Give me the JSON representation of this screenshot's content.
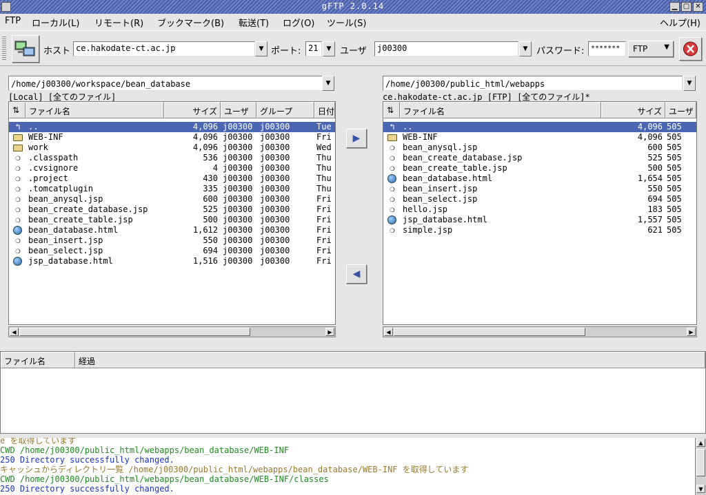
{
  "window": {
    "title": "gFTP 2.0.14"
  },
  "menu": [
    "FTP",
    "ローカル(L)",
    "リモート(R)",
    "ブックマーク(B)",
    "転送(T)",
    "ログ(O)",
    "ツール(S)"
  ],
  "menu_help": "ヘルプ(H)",
  "toolbar": {
    "host_label": "ホスト",
    "host_value": "ce.hakodate-ct.ac.jp",
    "port_label": "ポート:",
    "port_value": "21",
    "user_label": "ユーザ",
    "user_value": "j00300",
    "password_label": "パスワード:",
    "password_value": "*******",
    "protocol_value": "FTP"
  },
  "local": {
    "path": "/home/j00300/workspace/bean_database",
    "status": "[Local] [全てのファイル]",
    "columns": {
      "name": "ファイル名",
      "size": "サイズ",
      "user": "ユーザ",
      "group": "グループ",
      "date": "日付"
    },
    "rows": [
      {
        "icon": "up",
        "name": "..",
        "size": "4,096",
        "user": "j00300",
        "group": "j00300",
        "date": "Tue"
      },
      {
        "icon": "folder",
        "name": "WEB-INF",
        "size": "4,096",
        "user": "j00300",
        "group": "j00300",
        "date": "Fri"
      },
      {
        "icon": "folder",
        "name": "work",
        "size": "4,096",
        "user": "j00300",
        "group": "j00300",
        "date": "Wed"
      },
      {
        "icon": "file",
        "name": ".classpath",
        "size": "536",
        "user": "j00300",
        "group": "j00300",
        "date": "Thu"
      },
      {
        "icon": "file",
        "name": ".cvsignore",
        "size": "4",
        "user": "j00300",
        "group": "j00300",
        "date": "Thu"
      },
      {
        "icon": "file",
        "name": ".project",
        "size": "430",
        "user": "j00300",
        "group": "j00300",
        "date": "Thu"
      },
      {
        "icon": "file",
        "name": ".tomcatplugin",
        "size": "335",
        "user": "j00300",
        "group": "j00300",
        "date": "Thu"
      },
      {
        "icon": "file",
        "name": "bean_anysql.jsp",
        "size": "600",
        "user": "j00300",
        "group": "j00300",
        "date": "Fri"
      },
      {
        "icon": "file",
        "name": "bean_create_database.jsp",
        "size": "525",
        "user": "j00300",
        "group": "j00300",
        "date": "Fri"
      },
      {
        "icon": "file",
        "name": "bean_create_table.jsp",
        "size": "500",
        "user": "j00300",
        "group": "j00300",
        "date": "Fri"
      },
      {
        "icon": "html",
        "name": "bean_database.html",
        "size": "1,612",
        "user": "j00300",
        "group": "j00300",
        "date": "Fri"
      },
      {
        "icon": "file",
        "name": "bean_insert.jsp",
        "size": "550",
        "user": "j00300",
        "group": "j00300",
        "date": "Fri"
      },
      {
        "icon": "file",
        "name": "bean_select.jsp",
        "size": "694",
        "user": "j00300",
        "group": "j00300",
        "date": "Fri"
      },
      {
        "icon": "html",
        "name": "jsp_database.html",
        "size": "1,516",
        "user": "j00300",
        "group": "j00300",
        "date": "Fri"
      }
    ]
  },
  "remote": {
    "path": "/home/j00300/public_html/webapps",
    "status": "ce.hakodate-ct.ac.jp [FTP] [全てのファイル]*",
    "columns": {
      "name": "ファイル名",
      "size": "サイズ",
      "user": "ユーザ"
    },
    "rows": [
      {
        "icon": "up",
        "name": "..",
        "size": "4,096",
        "user": "505"
      },
      {
        "icon": "folder",
        "name": "WEB-INF",
        "size": "4,096",
        "user": "505"
      },
      {
        "icon": "file",
        "name": "bean_anysql.jsp",
        "size": "600",
        "user": "505"
      },
      {
        "icon": "file",
        "name": "bean_create_database.jsp",
        "size": "525",
        "user": "505"
      },
      {
        "icon": "file",
        "name": "bean_create_table.jsp",
        "size": "500",
        "user": "505"
      },
      {
        "icon": "html",
        "name": "bean_database.html",
        "size": "1,654",
        "user": "505"
      },
      {
        "icon": "file",
        "name": "bean_insert.jsp",
        "size": "550",
        "user": "505"
      },
      {
        "icon": "file",
        "name": "bean_select.jsp",
        "size": "694",
        "user": "505"
      },
      {
        "icon": "file",
        "name": "hello.jsp",
        "size": "183",
        "user": "505"
      },
      {
        "icon": "html",
        "name": "jsp_database.html",
        "size": "1,557",
        "user": "505"
      },
      {
        "icon": "file",
        "name": "simple.jsp",
        "size": "621",
        "user": "505"
      }
    ]
  },
  "transfer": {
    "columns": {
      "name": "ファイル名",
      "progress": "経過"
    }
  },
  "log": [
    {
      "type": "brown",
      "text": "e を取得しています"
    },
    {
      "type": "green",
      "text": "CWD /home/j00300/public_html/webapps/bean_database/WEB-INF"
    },
    {
      "type": "blue",
      "text": "250 Directory successfully changed."
    },
    {
      "type": "brown",
      "text": "キャッシュからディレクトリ一覧 /home/j00300/public_html/webapps/bean_database/WEB-INF を取得しています"
    },
    {
      "type": "green",
      "text": "CWD /home/j00300/public_html/webapps/bean_database/WEB-INF/classes"
    },
    {
      "type": "blue",
      "text": "250 Directory successfully changed."
    }
  ]
}
